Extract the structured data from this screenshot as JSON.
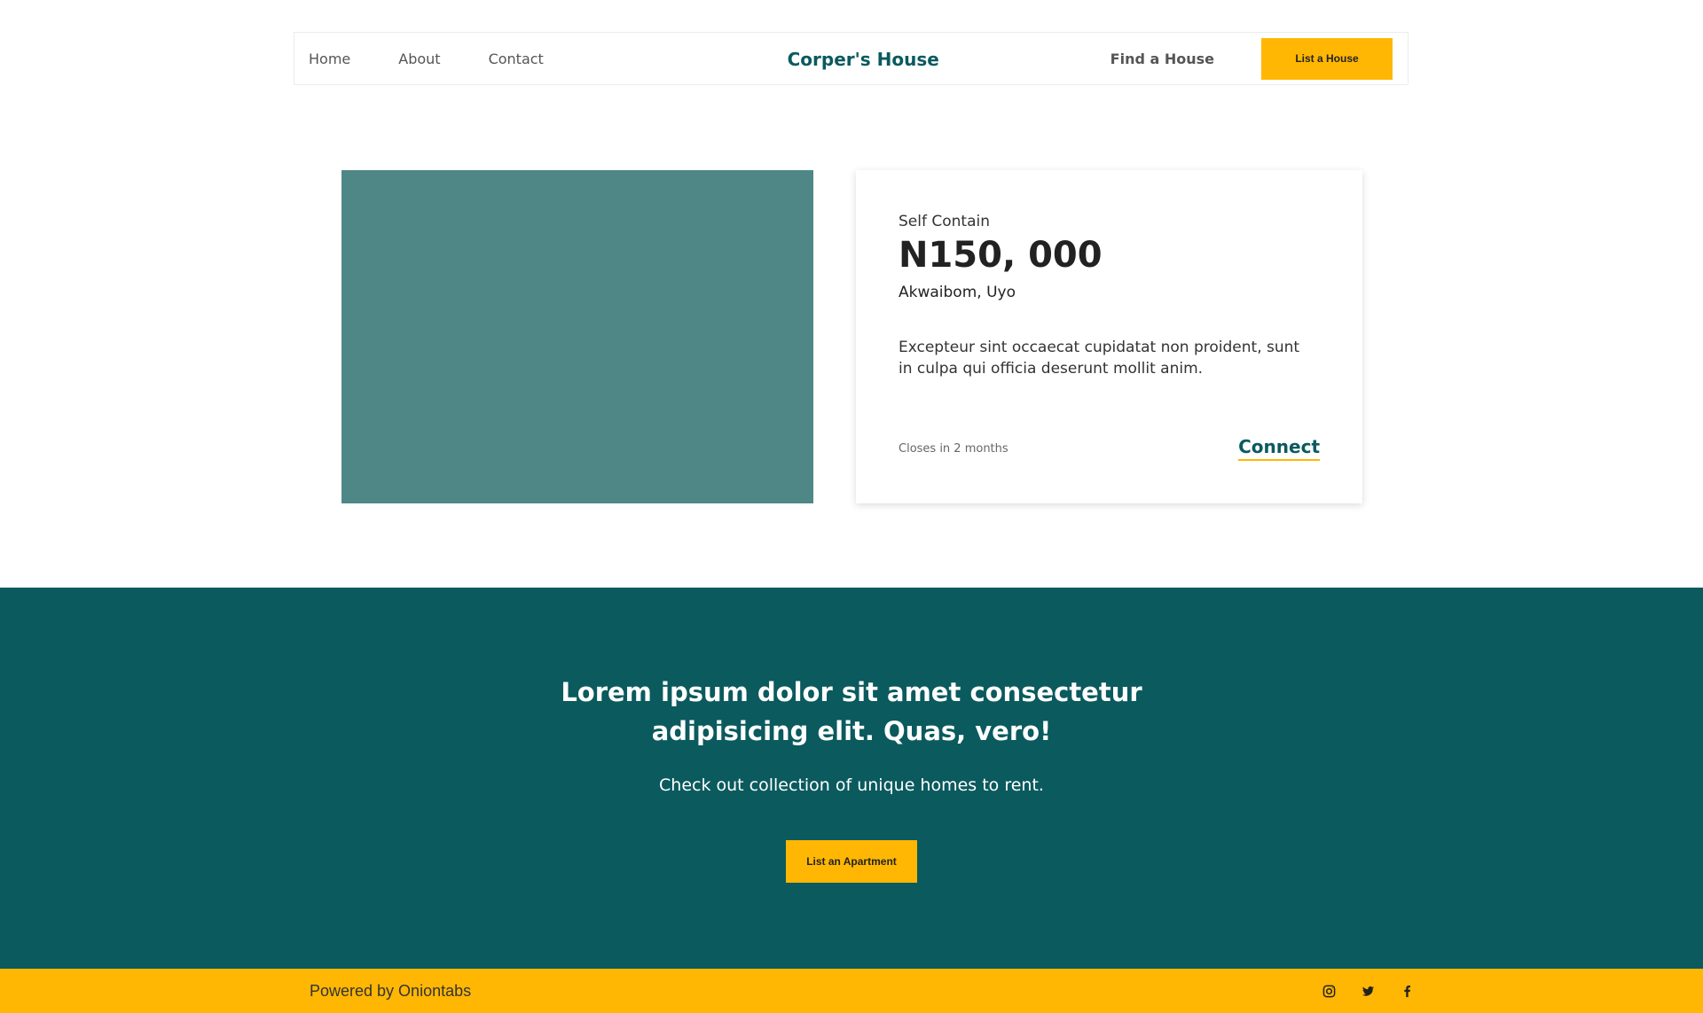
{
  "nav": {
    "links": [
      "Home",
      "About",
      "Contact"
    ],
    "brand": "Corper's House",
    "find_link": "Find a House",
    "cta": "List a House"
  },
  "listing": {
    "type": "Self Contain",
    "price": "N150, 000",
    "location": "Akwaibom, Uyo",
    "description": "Excepteur sint occaecat cupidatat non proident, sunt in culpa qui officia deserunt mollit anim.",
    "closes": "Closes in 2 months",
    "connect": "Connect"
  },
  "band": {
    "title_line1": "Lorem ipsum dolor sit amet consectetur",
    "title_line2": "adipisicing elit. Quas, vero!",
    "subtitle": "Check out collection of unique homes to rent.",
    "cta": "List an Apartment"
  },
  "footer": {
    "powered": "Powered by Oniontabs",
    "socials": [
      "instagram-icon",
      "twitter-icon",
      "facebook-icon"
    ]
  },
  "colors": {
    "brand": "#0a5a5e",
    "accent": "#ffb703",
    "image_placeholder": "#4f8787"
  }
}
